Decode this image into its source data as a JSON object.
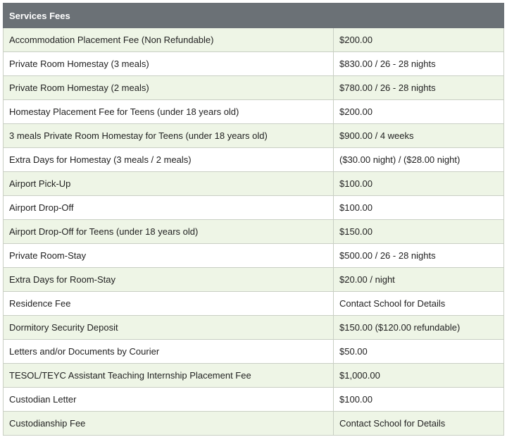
{
  "table": {
    "header": "Services Fees",
    "rows": [
      {
        "service": "Accommodation Placement Fee (Non Refundable)",
        "price": "$200.00"
      },
      {
        "service": "Private Room Homestay (3 meals)",
        "price": "$830.00 / 26 - 28 nights"
      },
      {
        "service": "Private Room Homestay (2 meals)",
        "price": "$780.00 / 26 - 28 nights"
      },
      {
        "service": "Homestay Placement Fee for Teens (under 18 years old)",
        "price": "$200.00"
      },
      {
        "service": "3 meals Private Room Homestay for Teens (under 18 years old)",
        "price": "$900.00 / 4 weeks"
      },
      {
        "service": "Extra Days for Homestay (3 meals / 2 meals)",
        "price": "($30.00 night) / ($28.00 night)"
      },
      {
        "service": "Airport Pick-Up",
        "price": "$100.00"
      },
      {
        "service": "Airport Drop-Off",
        "price": "$100.00"
      },
      {
        "service": "Airport Drop-Off for Teens (under 18 years old)",
        "price": "$150.00"
      },
      {
        "service": "Private Room-Stay",
        "price": "$500.00 / 26 - 28 nights"
      },
      {
        "service": "Extra Days for Room-Stay",
        "price": "$20.00 / night"
      },
      {
        "service": "Residence Fee",
        "price": "Contact School for Details"
      },
      {
        "service": "Dormitory Security Deposit",
        "price": "$150.00 ($120.00 refundable)"
      },
      {
        "service": "Letters and/or Documents by Courier",
        "price": "$50.00"
      },
      {
        "service": "TESOL/TEYC Assistant Teaching Internship Placement Fee",
        "price": "$1,000.00"
      },
      {
        "service": "Custodian Letter",
        "price": "$100.00"
      },
      {
        "service": "Custodianship Fee",
        "price": "Contact School for Details"
      }
    ]
  },
  "colors": {
    "header_bg": "#6b7176",
    "row_tint": "#eef5e6",
    "border": "#c9cfc4"
  }
}
